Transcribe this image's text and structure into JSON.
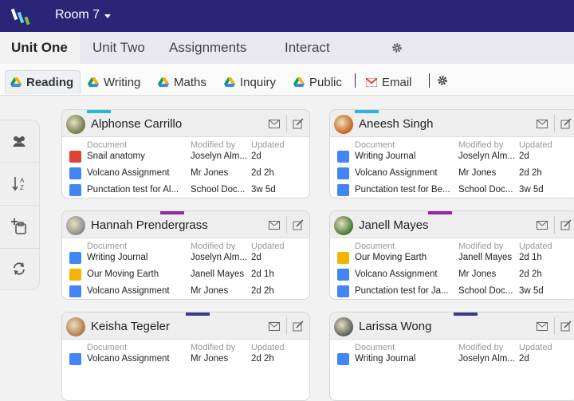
{
  "header": {
    "room_label": "Room 7"
  },
  "units": [
    "Unit One",
    "Unit Two",
    "Assignments",
    "Interact"
  ],
  "subtabs": [
    "Reading",
    "Writing",
    "Maths",
    "Inquiry",
    "Public",
    "Email"
  ],
  "columns": {
    "document": "Document",
    "modified_by": "Modified by",
    "updated": "Updated"
  },
  "cards": [
    {
      "name": "Alphonse Carrillo",
      "accent": "#29b6d8",
      "rows": [
        {
          "doc": "Snail anatomy",
          "by": "Joselyn Alm...",
          "updated": "2d",
          "type": "red"
        },
        {
          "doc": "Volcano Assignment",
          "by": "Mr Jones",
          "updated": "2d 2h",
          "type": "blue"
        },
        {
          "doc": "Punctation test for Al...",
          "by": "School Doc...",
          "updated": "3w 5d",
          "type": "blue"
        }
      ]
    },
    {
      "name": "Aneesh Singh",
      "accent": "#29b6d8",
      "rows": [
        {
          "doc": "Writing Journal",
          "by": "Joselyn Alm...",
          "updated": "2d",
          "type": "blue"
        },
        {
          "doc": "Volcano Assignment",
          "by": "Mr Jones",
          "updated": "2d 2h",
          "type": "blue"
        },
        {
          "doc": "Punctation test for Be...",
          "by": "School Doc...",
          "updated": "3w 5d",
          "type": "blue"
        }
      ]
    },
    {
      "name": "Hannah Prendergrass",
      "accent": "#8e2a9e",
      "rows": [
        {
          "doc": "Writing Journal",
          "by": "Joselyn Alm...",
          "updated": "2d",
          "type": "blue"
        },
        {
          "doc": "Our Moving Earth",
          "by": "Janell Mayes",
          "updated": "2d 1h",
          "type": "yellow"
        },
        {
          "doc": "Volcano Assignment",
          "by": "Mr Jones",
          "updated": "2d 2h",
          "type": "blue"
        }
      ]
    },
    {
      "name": "Janell Mayes",
      "accent": "#8e2a9e",
      "rows": [
        {
          "doc": "Our Moving Earth",
          "by": "Janell Mayes",
          "updated": "2d 1h",
          "type": "yellow"
        },
        {
          "doc": "Volcano Assignment",
          "by": "Mr Jones",
          "updated": "2d 2h",
          "type": "blue"
        },
        {
          "doc": "Punctation test for Ja...",
          "by": "School Doc...",
          "updated": "3w 5d",
          "type": "blue"
        }
      ]
    },
    {
      "name": "Keisha Tegeler",
      "accent": "#3a3a8a",
      "rows": [
        {
          "doc": "Volcano Assignment",
          "by": "Mr Jones",
          "updated": "2d 2h",
          "type": "blue"
        }
      ]
    },
    {
      "name": "Larissa Wong",
      "accent": "#3a3a8a",
      "rows": [
        {
          "doc": "Writing Journal",
          "by": "Joselyn Alm...",
          "updated": "2d",
          "type": "blue"
        }
      ]
    }
  ],
  "colors": {
    "header_bg": "#2a2576",
    "doc_blue": "#4285f4",
    "doc_red": "#db4437",
    "doc_yellow": "#f4b400"
  }
}
